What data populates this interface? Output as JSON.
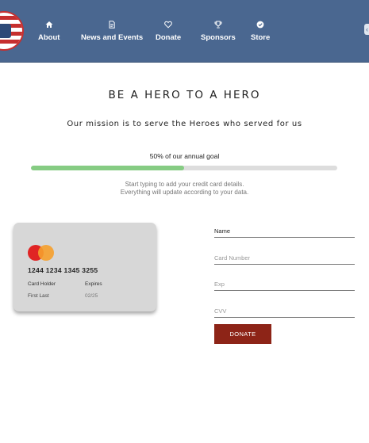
{
  "nav": {
    "items": [
      {
        "label": "About",
        "icon": "home-icon"
      },
      {
        "label": "News and Events",
        "icon": "document-icon"
      },
      {
        "label": "Donate",
        "icon": "heart-icon"
      },
      {
        "label": "Sponsors",
        "icon": "trophy-icon"
      },
      {
        "label": "Store",
        "icon": "store-badge-icon"
      }
    ]
  },
  "main": {
    "title": "BE A HERO TO A HERO",
    "mission": "Our mission is to serve the Heroes who served for us",
    "goal_text": "50% of our annual goal",
    "goal_progress": 0.5,
    "help_line1": "Start typing to add your credit card details.",
    "help_line2": "Everything will update according to your data."
  },
  "card": {
    "brand_icon": "mastercard-icon",
    "number": "1244 1234 1345 3255",
    "holder_label": "Card Holder",
    "holder_value": "First Last",
    "expires_label": "Expires",
    "expires_value": "02/25"
  },
  "form": {
    "name_placeholder": "Name",
    "card_number_placeholder": "Card Number",
    "exp_placeholder": "Exp",
    "cvv_placeholder": "CVV",
    "donate_label": "DONATE"
  },
  "colors": {
    "header": "#4a6790",
    "progress": "#86cc83",
    "donate_button": "#8d2417",
    "card": "#d7d7d7"
  }
}
